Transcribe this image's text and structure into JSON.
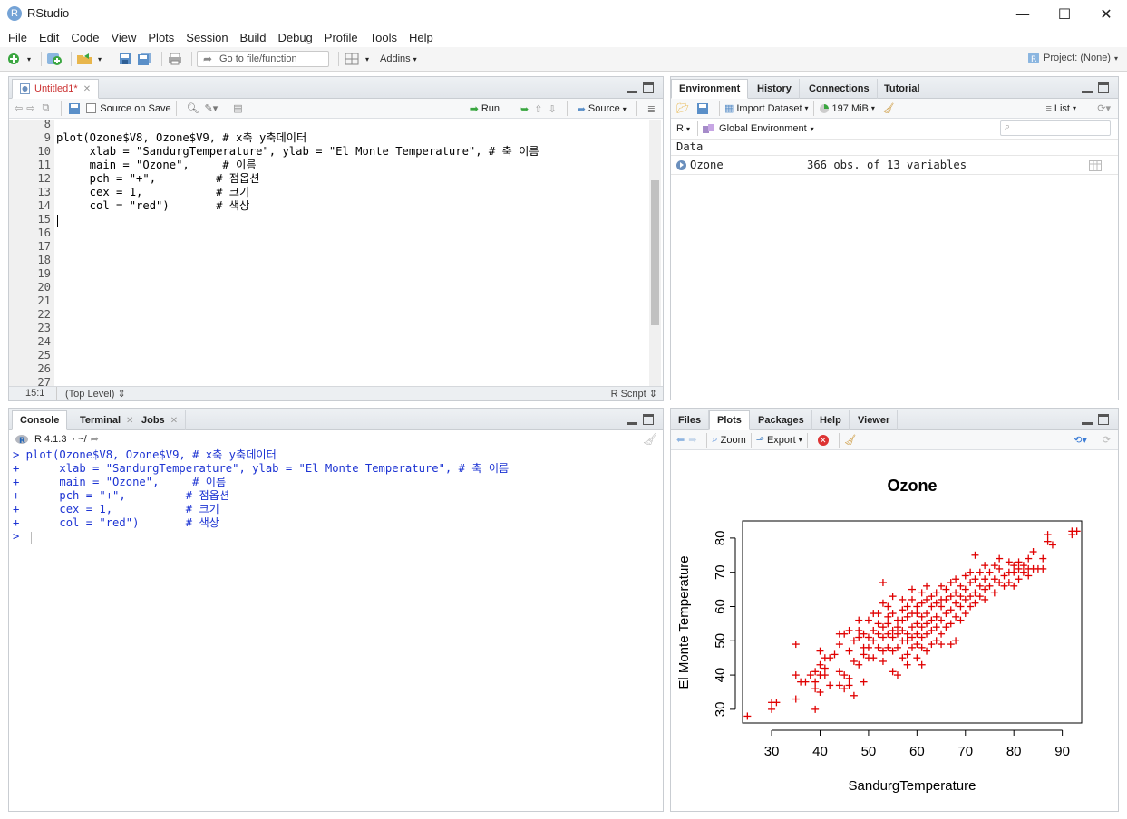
{
  "window": {
    "app_icon": "R",
    "title": "RStudio",
    "minimize_glyph": "—",
    "maximize_glyph": "☐",
    "close_glyph": "✕"
  },
  "menu": [
    "File",
    "Edit",
    "Code",
    "View",
    "Plots",
    "Session",
    "Build",
    "Debug",
    "Profile",
    "Tools",
    "Help"
  ],
  "toolbar": {
    "goto_placeholder": "Go to file/function",
    "addins_label": "Addins",
    "project_label": "Project: (None)"
  },
  "editor": {
    "tab_label": "Untitled1*",
    "source_on_save_label": "Source on Save",
    "run_label": "Run",
    "source_label": "Source",
    "line_numbers": [
      "8",
      "9",
      "10",
      "11",
      "12",
      "13",
      "14",
      "15",
      "16",
      "17",
      "18",
      "19",
      "20",
      "21",
      "22",
      "23",
      "24",
      "25",
      "26",
      "27"
    ],
    "lines": [
      "",
      "plot(Ozone$V8, Ozone$V9, # x축 y축데이터",
      "     xlab = \"SandurgTemperature\", ylab = \"El Monte Temperature\", # 축 이름",
      "     main = \"Ozone\",     # 이름",
      "     pch = \"+\",         # 점옵션",
      "     cex = 1,           # 크기",
      "     col = \"red\")       # 색상"
    ],
    "status_position": "15:1",
    "status_scope": "(Top Level)",
    "status_type": "R Script"
  },
  "console": {
    "tabs": [
      "Console",
      "Terminal",
      "Jobs"
    ],
    "r_version": "R 4.1.3",
    "cwd": "· ~/",
    "lines": [
      "> plot(Ozone$V8, Ozone$V9, # x축 y축데이터",
      "+      xlab = \"SandurgTemperature\", ylab = \"El Monte Temperature\", # 축 이름",
      "+      main = \"Ozone\",     # 이름",
      "+      pch = \"+\",         # 점옵션",
      "+      cex = 1,           # 크기",
      "+      col = \"red\")       # 색상",
      "> "
    ]
  },
  "environment": {
    "tabs": [
      "Environment",
      "History",
      "Connections",
      "Tutorial"
    ],
    "import_label": "Import Dataset",
    "memory_label": "197 MiB",
    "list_label": "List",
    "r_label": "R",
    "scope_label": "Global Environment",
    "section": "Data",
    "rows": [
      {
        "name": "Ozone",
        "value": "366 obs. of 13 variables"
      }
    ]
  },
  "files": {
    "tabs": [
      "Files",
      "Plots",
      "Packages",
      "Help",
      "Viewer"
    ],
    "zoom_label": "Zoom",
    "export_label": "Export"
  },
  "chart_data": {
    "type": "scatter",
    "title": "Ozone",
    "xlabel": "SandurgTemperature",
    "ylabel": "El Monte Temperature",
    "marker": "+",
    "color": "#e00000",
    "xlim": [
      24,
      94
    ],
    "ylim": [
      26,
      85
    ],
    "xticks": [
      30,
      40,
      50,
      60,
      70,
      80,
      90
    ],
    "yticks": [
      30,
      40,
      50,
      60,
      70,
      80
    ],
    "grid": false,
    "points": [
      [
        25,
        28
      ],
      [
        30,
        30
      ],
      [
        30,
        32
      ],
      [
        31,
        32
      ],
      [
        35,
        33
      ],
      [
        35,
        40
      ],
      [
        35,
        49
      ],
      [
        36,
        38
      ],
      [
        37,
        38
      ],
      [
        38,
        40
      ],
      [
        39,
        30
      ],
      [
        39,
        36
      ],
      [
        39,
        38
      ],
      [
        39,
        41
      ],
      [
        40,
        35
      ],
      [
        40,
        40
      ],
      [
        40,
        43
      ],
      [
        40,
        47
      ],
      [
        41,
        40
      ],
      [
        41,
        42
      ],
      [
        41,
        45
      ],
      [
        42,
        37
      ],
      [
        42,
        45
      ],
      [
        43,
        46
      ],
      [
        44,
        37
      ],
      [
        44,
        41
      ],
      [
        44,
        49
      ],
      [
        44,
        52
      ],
      [
        45,
        36
      ],
      [
        45,
        40
      ],
      [
        45,
        52
      ],
      [
        46,
        37
      ],
      [
        46,
        39
      ],
      [
        46,
        47
      ],
      [
        46,
        53
      ],
      [
        47,
        34
      ],
      [
        47,
        44
      ],
      [
        47,
        50
      ],
      [
        48,
        43
      ],
      [
        48,
        51
      ],
      [
        48,
        53
      ],
      [
        48,
        56
      ],
      [
        49,
        38
      ],
      [
        49,
        46
      ],
      [
        49,
        48
      ],
      [
        49,
        52
      ],
      [
        50,
        45
      ],
      [
        50,
        48
      ],
      [
        50,
        51
      ],
      [
        50,
        56
      ],
      [
        51,
        45
      ],
      [
        51,
        50
      ],
      [
        51,
        53
      ],
      [
        51,
        58
      ],
      [
        52,
        48
      ],
      [
        52,
        52
      ],
      [
        52,
        55
      ],
      [
        52,
        58
      ],
      [
        53,
        44
      ],
      [
        53,
        47
      ],
      [
        53,
        51
      ],
      [
        53,
        54
      ],
      [
        53,
        61
      ],
      [
        53,
        67
      ],
      [
        54,
        48
      ],
      [
        54,
        52
      ],
      [
        54,
        55
      ],
      [
        54,
        57
      ],
      [
        54,
        60
      ],
      [
        55,
        41
      ],
      [
        55,
        47
      ],
      [
        55,
        51
      ],
      [
        55,
        53
      ],
      [
        55,
        58
      ],
      [
        55,
        63
      ],
      [
        56,
        40
      ],
      [
        56,
        48
      ],
      [
        56,
        52
      ],
      [
        56,
        54
      ],
      [
        56,
        56
      ],
      [
        57,
        45
      ],
      [
        57,
        50
      ],
      [
        57,
        53
      ],
      [
        57,
        56
      ],
      [
        57,
        59
      ],
      [
        57,
        62
      ],
      [
        58,
        43
      ],
      [
        58,
        46
      ],
      [
        58,
        50
      ],
      [
        58,
        52
      ],
      [
        58,
        57
      ],
      [
        58,
        60
      ],
      [
        59,
        48
      ],
      [
        59,
        51
      ],
      [
        59,
        54
      ],
      [
        59,
        58
      ],
      [
        59,
        62
      ],
      [
        59,
        65
      ],
      [
        60,
        45
      ],
      [
        60,
        49
      ],
      [
        60,
        52
      ],
      [
        60,
        55
      ],
      [
        60,
        58
      ],
      [
        60,
        60
      ],
      [
        61,
        43
      ],
      [
        61,
        48
      ],
      [
        61,
        51
      ],
      [
        61,
        54
      ],
      [
        61,
        57
      ],
      [
        61,
        61
      ],
      [
        61,
        64
      ],
      [
        62,
        47
      ],
      [
        62,
        52
      ],
      [
        62,
        55
      ],
      [
        62,
        58
      ],
      [
        62,
        62
      ],
      [
        62,
        66
      ],
      [
        63,
        49
      ],
      [
        63,
        53
      ],
      [
        63,
        56
      ],
      [
        63,
        60
      ],
      [
        63,
        63
      ],
      [
        64,
        50
      ],
      [
        64,
        54
      ],
      [
        64,
        57
      ],
      [
        64,
        61
      ],
      [
        64,
        64
      ],
      [
        65,
        49
      ],
      [
        65,
        52
      ],
      [
        65,
        56
      ],
      [
        65,
        60
      ],
      [
        65,
        62
      ],
      [
        65,
        66
      ],
      [
        66,
        54
      ],
      [
        66,
        58
      ],
      [
        66,
        62
      ],
      [
        66,
        65
      ],
      [
        67,
        49
      ],
      [
        67,
        55
      ],
      [
        67,
        59
      ],
      [
        67,
        63
      ],
      [
        67,
        67
      ],
      [
        68,
        50
      ],
      [
        68,
        57
      ],
      [
        68,
        61
      ],
      [
        68,
        64
      ],
      [
        68,
        68
      ],
      [
        69,
        56
      ],
      [
        69,
        60
      ],
      [
        69,
        63
      ],
      [
        69,
        66
      ],
      [
        70,
        58
      ],
      [
        70,
        62
      ],
      [
        70,
        65
      ],
      [
        70,
        69
      ],
      [
        71,
        60
      ],
      [
        71,
        63
      ],
      [
        71,
        67
      ],
      [
        71,
        70
      ],
      [
        72,
        61
      ],
      [
        72,
        64
      ],
      [
        72,
        68
      ],
      [
        72,
        75
      ],
      [
        73,
        63
      ],
      [
        73,
        66
      ],
      [
        73,
        70
      ],
      [
        74,
        62
      ],
      [
        74,
        65
      ],
      [
        74,
        68
      ],
      [
        74,
        72
      ],
      [
        75,
        66
      ],
      [
        75,
        70
      ],
      [
        76,
        64
      ],
      [
        76,
        68
      ],
      [
        76,
        72
      ],
      [
        77,
        67
      ],
      [
        77,
        71
      ],
      [
        77,
        74
      ],
      [
        78,
        66
      ],
      [
        78,
        69
      ],
      [
        79,
        67
      ],
      [
        79,
        70
      ],
      [
        79,
        73
      ],
      [
        80,
        66
      ],
      [
        80,
        70
      ],
      [
        80,
        72
      ],
      [
        81,
        68
      ],
      [
        81,
        71
      ],
      [
        81,
        73
      ],
      [
        82,
        70
      ],
      [
        82,
        72
      ],
      [
        83,
        69
      ],
      [
        83,
        71
      ],
      [
        83,
        74
      ],
      [
        84,
        71
      ],
      [
        84,
        76
      ],
      [
        85,
        71
      ],
      [
        86,
        71
      ],
      [
        86,
        74
      ],
      [
        87,
        79
      ],
      [
        87,
        81
      ],
      [
        88,
        78
      ],
      [
        92,
        81
      ],
      [
        92,
        82
      ],
      [
        93,
        82
      ]
    ]
  }
}
